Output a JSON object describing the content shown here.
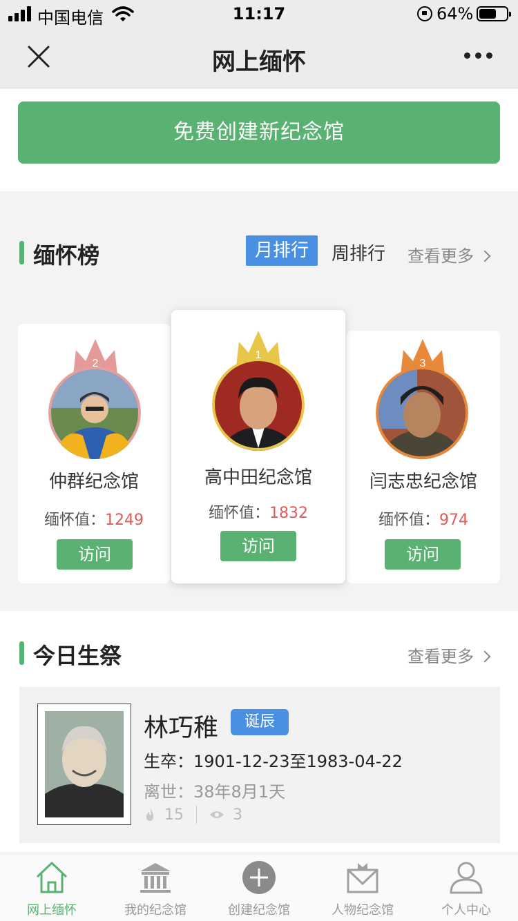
{
  "status_bar": {
    "carrier": "中国电信",
    "time": "11:17",
    "battery": "64%",
    "battery_level": 0.64
  },
  "nav": {
    "title": "网上缅怀"
  },
  "create_button": "免费创建新纪念馆",
  "ranking": {
    "title": "缅怀榜",
    "tab_month": "月排行",
    "tab_week": "周排行",
    "see_more": "查看更多",
    "score_label": "缅怀值：",
    "visit_label": "访问",
    "entries": [
      {
        "rank": "1",
        "name": "高中田纪念馆",
        "score": "1832",
        "crown_color": "#e8c64a"
      },
      {
        "rank": "2",
        "name": "仲群纪念馆",
        "score": "1249",
        "crown_color": "#e59a9a"
      },
      {
        "rank": "3",
        "name": "闫志忠纪念馆",
        "score": "974",
        "crown_color": "#e8883a"
      }
    ]
  },
  "today": {
    "title": "今日生祭",
    "see_more": "查看更多",
    "person": {
      "name": "林巧稚",
      "badge": "诞辰",
      "dates": "生卒：1901-12-23至1983-04-22",
      "passed": "离世：38年8月1天",
      "flame_count": "15",
      "view_count": "3"
    }
  },
  "tabbar": [
    {
      "label": "网上缅怀",
      "icon": "home-icon",
      "active": true
    },
    {
      "label": "我的纪念馆",
      "icon": "memorial-hall-icon",
      "active": false
    },
    {
      "label": "创建纪念馆",
      "icon": "plus-circle-icon",
      "active": false
    },
    {
      "label": "人物纪念馆",
      "icon": "person-memorial-icon",
      "active": false
    },
    {
      "label": "个人中心",
      "icon": "user-icon",
      "active": false
    }
  ]
}
